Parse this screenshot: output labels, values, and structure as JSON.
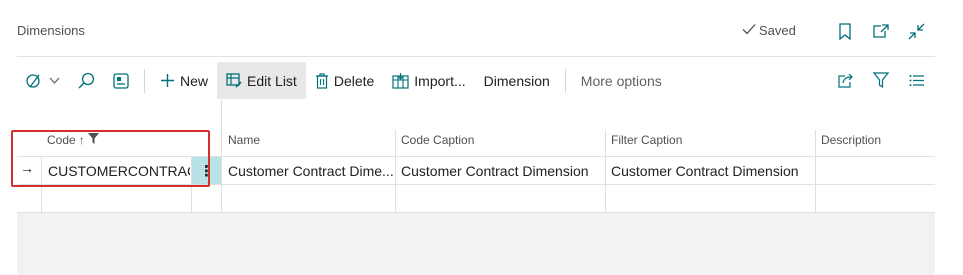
{
  "header": {
    "title": "Dimensions",
    "saved_label": "Saved",
    "icons": [
      "checkmark-icon",
      "bookmark-icon",
      "open-new-window-icon",
      "collapse-icon"
    ]
  },
  "toolbar": {
    "new_label": "New",
    "edit_list_label": "Edit List",
    "delete_label": "Delete",
    "import_label": "Import...",
    "dimension_label": "Dimension",
    "more_options_label": "More options"
  },
  "table": {
    "columns": [
      "Code",
      "Name",
      "Code Caption",
      "Filter Caption",
      "Description"
    ],
    "sort_indicator": "↑",
    "rows": [
      {
        "code": "CUSTOMERCONTRACT",
        "name": "Customer Contract Dime...",
        "code_caption": "Customer Contract Dimension",
        "filter_caption": "Customer Contract Dimension",
        "description": ""
      }
    ],
    "row_arrow": "→",
    "row_menu": "⋮"
  },
  "colors": {
    "accent": "#00707a",
    "selection_outline": "#d32f2f",
    "handle_bg": "#b9e2e6"
  }
}
